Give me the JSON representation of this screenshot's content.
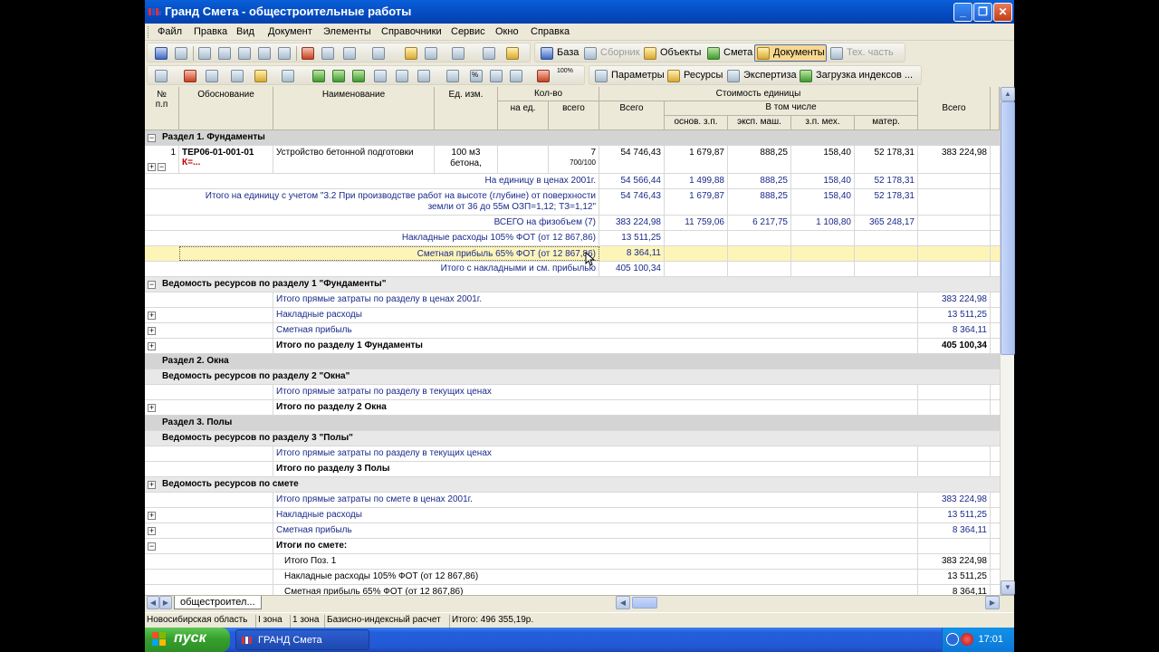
{
  "window": {
    "title": "Гранд Смета - общестроительные работы",
    "min_glyph": "_",
    "max_glyph": "❐",
    "close_glyph": "✕"
  },
  "menu": [
    "Файл",
    "Правка",
    "Вид",
    "Документ",
    "Элементы",
    "Справочники",
    "Сервис",
    "Окно",
    "Справка"
  ],
  "toolbar1": {
    "baza": "База",
    "sbornik": "Сборник",
    "objects": "Объекты",
    "smeta": "Смета",
    "documents": "Документы",
    "tech": "Тех. часть"
  },
  "toolbar2": {
    "percent": "%",
    "percent100": "100%",
    "params": "Параметры",
    "resources": "Ресурсы",
    "expertise": "Экспертиза",
    "load_indexes": "Загрузка индексов ..."
  },
  "header": {
    "num": "№\nп.п",
    "basis": "Обоснование",
    "name": "Наименование",
    "unit": "Ед. изм.",
    "qty": "Кол-во",
    "qty_per_unit": "на ед.",
    "qty_total": "всего",
    "unit_cost": "Стоимость единицы",
    "uc_total": "Всего",
    "incl": "В том числе",
    "osn_zp": "основ. з.п.",
    "eksp_mash": "эксп. маш.",
    "zp_meh": "з.п. мех.",
    "mater": "матер.",
    "total": "Всего"
  },
  "rows": {
    "r1": "Раздел 1. Фундаменты",
    "r2_num": "1",
    "r2_code": "ТЕР06-01-001-01",
    "r2_k": "К=...",
    "r2_name": "Устройство бетонной подготовки",
    "r2_unit": "100 м3 бетона,",
    "r2_qty": "7",
    "r2_qty_frac": "700/100",
    "r2_total": "54 746,43",
    "r2_zp": "1 679,87",
    "r2_mash": "888,25",
    "r2_meh": "158,40",
    "r2_mat": "52 178,31",
    "r2_sum": "383 224,98",
    "r3_label": "На единицу в ценах 2001г.",
    "r3_total": "54 566,44",
    "r3_zp": "1 499,88",
    "r3_mash": "888,25",
    "r3_meh": "158,40",
    "r3_mat": "52 178,31",
    "r4_line1": "Итого на единицу с учетом \"3.2 При производстве работ на высоте (глубине) от поверхности",
    "r4_line2": "земли от 36 до 55м ОЗП=1,12; ТЗ=1,12\"",
    "r4_total": "54 746,43",
    "r4_zp": "1 679,87",
    "r4_mash": "888,25",
    "r4_meh": "158,40",
    "r4_mat": "52 178,31",
    "r5_label": "ВСЕГО на физобъем (7)",
    "r5_total": "383 224,98",
    "r5_zp": "11 759,06",
    "r5_mash": "6 217,75",
    "r5_meh": "1 108,80",
    "r5_mat": "365 248,17",
    "r6_label": "Накладные расходы 105% ФОТ (от 12 867,86)",
    "r6_total": "13 511,25",
    "r7_label": "Сметная прибыль 65% ФОТ (от 12 867,86)",
    "r7_total": "8 364,11",
    "r8_label": "Итого с накладными и см. прибылью",
    "r8_total": "405 100,34",
    "r9": "Ведомость ресурсов по разделу 1 \"Фундаменты\"",
    "r10_label": "Итого прямые затраты по разделу в ценах 2001г.",
    "r10_sum": "383 224,98",
    "r11_label": "Накладные расходы",
    "r11_sum": "13 511,25",
    "r12_label": "Сметная прибыль",
    "r12_sum": "8 364,11",
    "r13_label": "Итого по разделу 1 Фундаменты",
    "r13_sum": "405 100,34",
    "r14": "Раздел 2. Окна",
    "r15": "Ведомость ресурсов по разделу 2 \"Окна\"",
    "r16_label": "Итого прямые затраты по разделу в текущих ценах",
    "r17_label": "Итого по разделу 2 Окна",
    "r18": "Раздел 3. Полы",
    "r19": "Ведомость ресурсов по разделу 3 \"Полы\"",
    "r20_label": "Итого прямые затраты по разделу в текущих ценах",
    "r21_label": "Итого по разделу 3 Полы",
    "r22": "Ведомость ресурсов по смете",
    "r23_label": "Итого прямые затраты по смете в ценах 2001г.",
    "r23_sum": "383 224,98",
    "r24_label": "Накладные расходы",
    "r24_sum": "13 511,25",
    "r25_label": "Сметная прибыль",
    "r25_sum": "8 364,11",
    "r26_label": "Итоги по смете:",
    "r27_label": "Итого Поз. 1",
    "r27_sum": "383 224,98",
    "r28_label": "Накладные расходы 105% ФОТ (от 12 867,86)",
    "r28_sum": "13 511,25",
    "r29_label": "Сметная прибыль 65% ФОТ (от 12 867,86)",
    "r29_sum": "8 364,11"
  },
  "sheet_tab": "общестроител...",
  "status": {
    "region": "Новосибирская область",
    "zone1": "I зона",
    "zone2": "1 зона",
    "method": "Базисно-индексный расчет",
    "total": "Итого: 496 355,19р."
  },
  "taskbar": {
    "start": "пуск",
    "app": "ГРАНД Смета",
    "clock": "17:01"
  }
}
